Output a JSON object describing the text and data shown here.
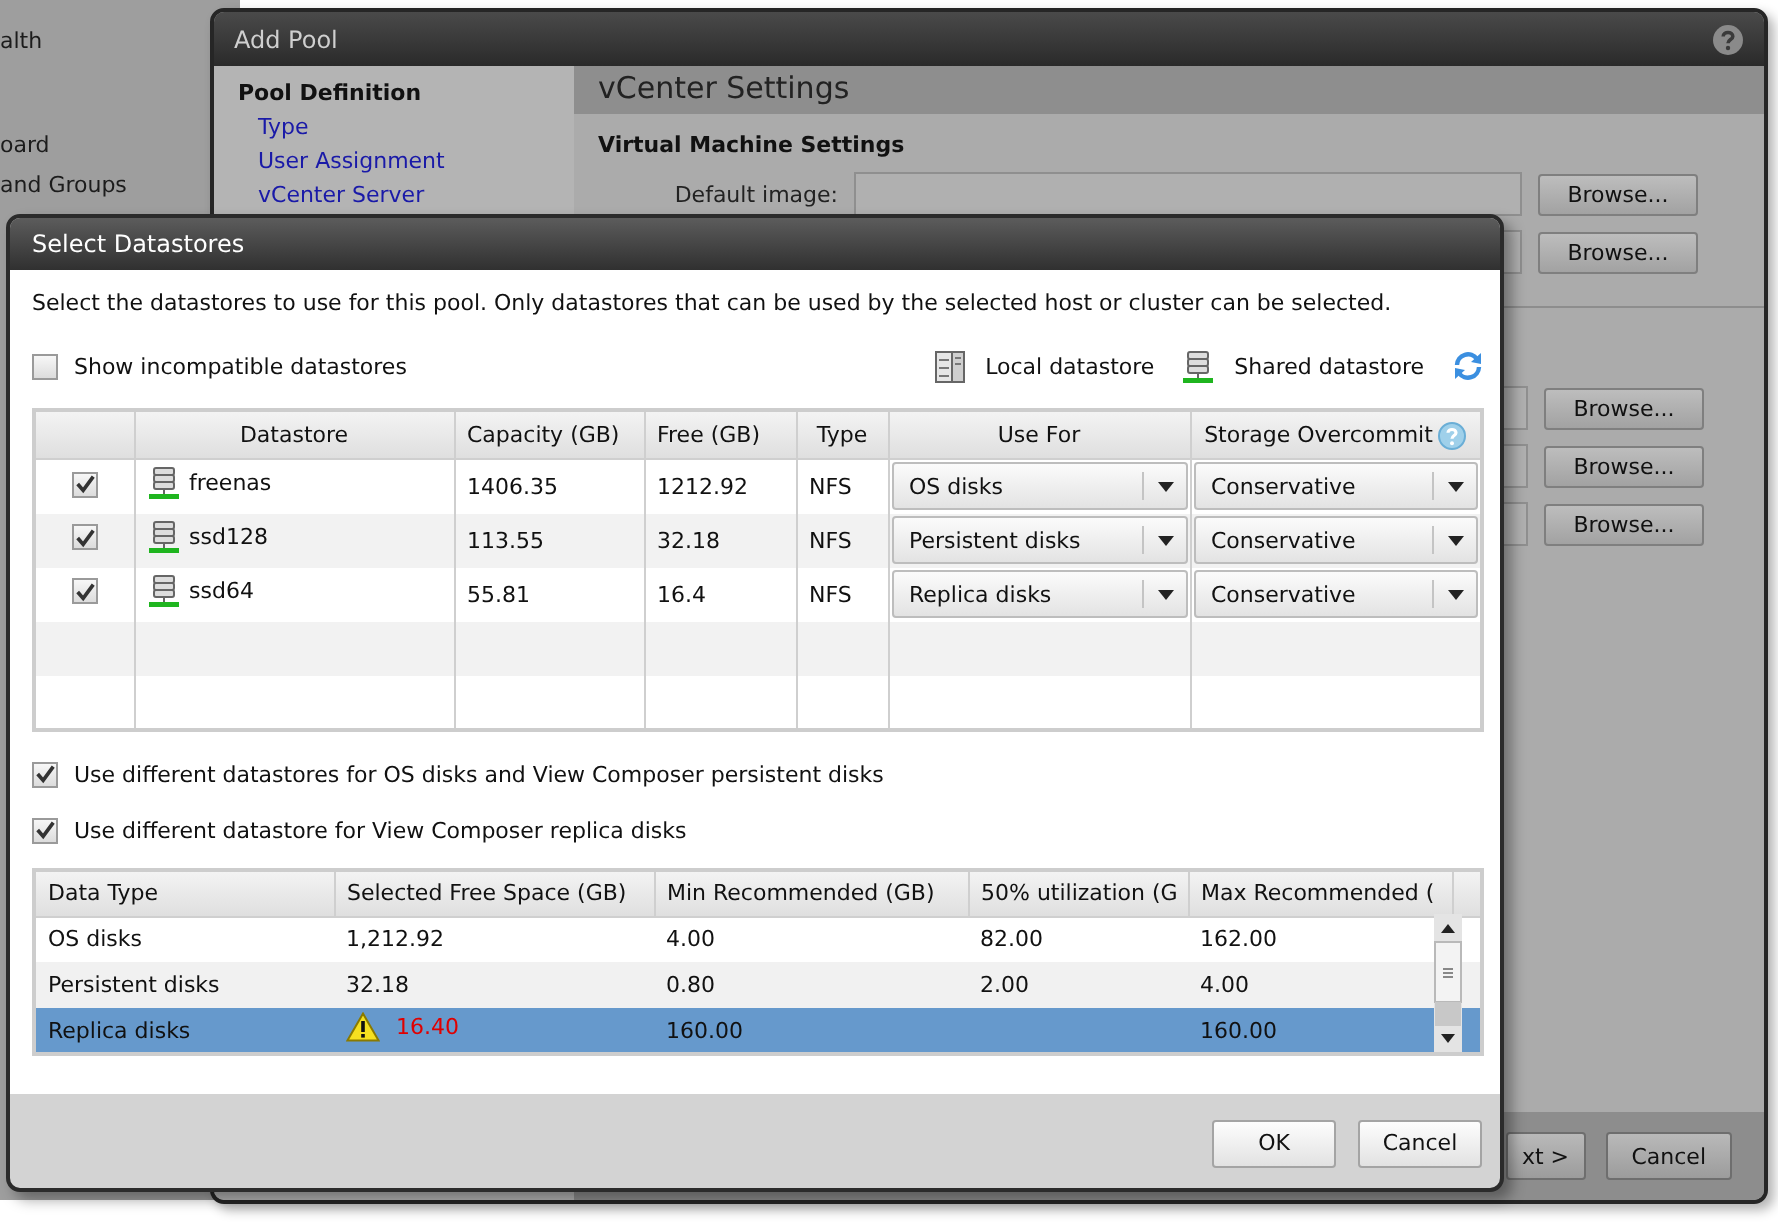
{
  "sidebar": {
    "items": [
      {
        "label": "alth"
      },
      {
        "label": "oard"
      },
      {
        "label": "and Groups"
      }
    ]
  },
  "add_pool": {
    "title": "Add Pool",
    "nav": {
      "heading": "Pool Definition",
      "items": [
        {
          "label": "Type"
        },
        {
          "label": "User Assignment"
        },
        {
          "label": "vCenter Server"
        }
      ]
    },
    "section_title": "vCenter Settings",
    "subsection_title": "Virtual Machine Settings",
    "default_image_label": "Default image:",
    "browse_buttons": [
      "Browse...",
      "Browse...",
      "Browse...",
      "Browse...",
      "Browse..."
    ],
    "footer_buttons": [
      "xt >",
      "Cancel"
    ]
  },
  "select_datastores": {
    "title": "Select Datastores",
    "instruction": "Select the datastores to use for this pool. Only datastores that can be used by the selected host or cluster can be selected.",
    "show_incompatible": {
      "label": "Show incompatible datastores",
      "checked": false
    },
    "legend": [
      {
        "kind": "local",
        "label": "Local datastore"
      },
      {
        "kind": "shared",
        "label": "Shared datastore"
      }
    ],
    "table": {
      "columns": [
        "Datastore",
        "Capacity (GB)",
        "Free (GB)",
        "Type",
        "Use For",
        "Storage Overcommit"
      ],
      "rows": [
        {
          "checked": true,
          "kind": "shared",
          "name": "freenas",
          "capacity": "1406.35",
          "free": "1212.92",
          "type": "NFS",
          "use_for": "OS disks",
          "storage_overcommit": "Conservative"
        },
        {
          "checked": true,
          "kind": "shared",
          "name": "ssd128",
          "capacity": "113.55",
          "free": "32.18",
          "type": "NFS",
          "use_for": "Persistent disks",
          "storage_overcommit": "Conservative"
        },
        {
          "checked": true,
          "kind": "shared",
          "name": "ssd64",
          "capacity": "55.81",
          "free": "16.4",
          "type": "NFS",
          "use_for": "Replica disks",
          "storage_overcommit": "Conservative"
        }
      ]
    },
    "options": [
      {
        "label": "Use different datastores for OS disks and View Composer persistent disks",
        "checked": true
      },
      {
        "label": "Use different datastore for View Composer replica disks",
        "checked": true
      }
    ],
    "summary": {
      "columns": [
        "Data Type",
        "Selected Free Space (GB)",
        "Min Recommended (GB)",
        "50% utilization (G",
        "Max Recommended ("
      ],
      "rows": [
        {
          "data_type": "OS disks",
          "selected_free_space": "1,212.92",
          "warning": false,
          "min_recommended": "4.00",
          "utilization_50": "82.00",
          "max_recommended": "162.00",
          "selected": false
        },
        {
          "data_type": "Persistent disks",
          "selected_free_space": "32.18",
          "warning": false,
          "min_recommended": "0.80",
          "utilization_50": "2.00",
          "max_recommended": "4.00",
          "selected": false
        },
        {
          "data_type": "Replica disks",
          "selected_free_space": "16.40",
          "warning": true,
          "min_recommended": "160.00",
          "max_recommended": "160.00",
          "selected": true
        }
      ]
    },
    "buttons": [
      "OK",
      "Cancel"
    ]
  }
}
